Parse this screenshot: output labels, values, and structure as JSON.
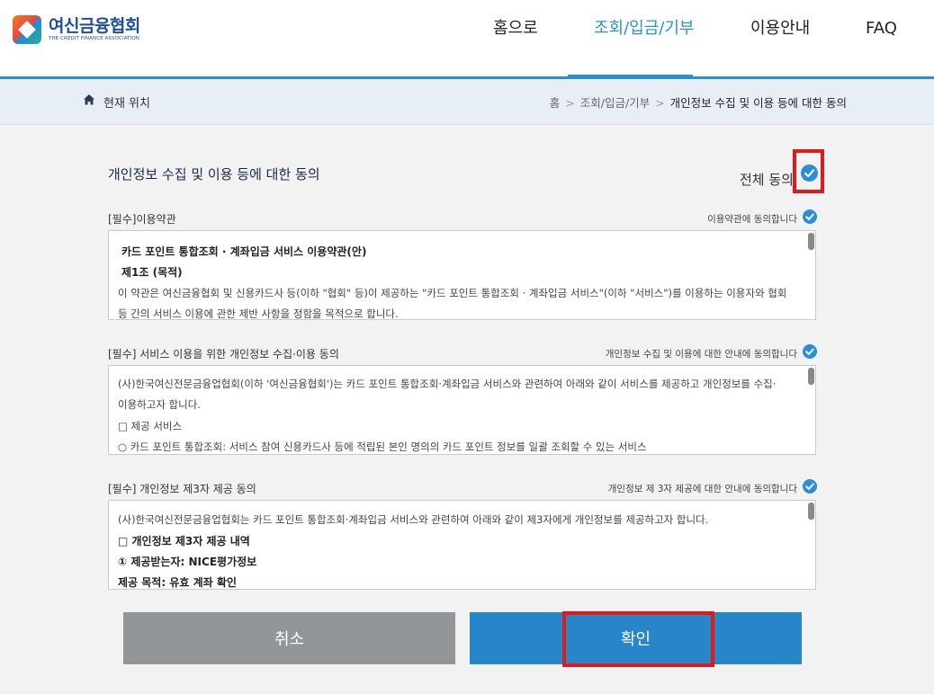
{
  "header": {
    "logo_kr": "여신금융협회",
    "logo_en": "THE CREDIT FINANCE ASSOCIATION",
    "nav": [
      {
        "label": "홈으로"
      },
      {
        "label": "조회/입금/기부",
        "active": true
      },
      {
        "label": "이용안내"
      },
      {
        "label": "FAQ"
      }
    ],
    "accent_color": "#2b8fd6"
  },
  "breadcrumb": {
    "label": "현재 위치",
    "items": [
      "홈",
      "조회/입금/기부",
      "개인정보 수집 및 이용 등에 대한 동의"
    ],
    "separator": ">"
  },
  "main": {
    "title": "개인정보 수집 및 이용 등에 대한 동의",
    "agree_all_label": "전체 동의",
    "sections": [
      {
        "title": "[필수]이용약관",
        "agree_label": "이용약관에 동의합니다",
        "lines": [
          "카드 포인트 통합조회 · 계좌입금 서비스 이용약관(안)",
          "제1조 (목적)",
          "이 약관은 여신금융협회 및 신용카드사 등(이하 \"협회\" 등)이 제공하는 \"카드 포인트 통합조회 · 계좌입금 서비스\"(이하 \"서비스\")를 이용하는 이용자와 협회",
          "등 간의 서비스 이용에 관한 제반 사항을 정함을 목적으로 합니다."
        ]
      },
      {
        "title": "[필수] 서비스 이용을 위한 개인정보 수집·이용 동의",
        "agree_label": "개인정보 수집 및 이용에 대한 안내에 동의합니다",
        "lines": [
          "(사)한국여신전문금융업협회(이하 '여신금융협회')는 카드 포인트 통합조회·계좌입금 서비스와 관련하여 아래와 같이 서비스를 제공하고 개인정보를 수집·",
          "이용하고자 합니다.",
          "□ 제공 서비스",
          "○ 카드 포인트 통합조회: 서비스 참여 신용카드사 등에 적립된 본인 명의의 카드 포인트 정보를 일괄 조회할 수 있는 서비스"
        ]
      },
      {
        "title": "[필수] 개인정보 제3자 제공 동의",
        "agree_label": "개인정보 제 3자 제공에 대한 안내에 동의합니다",
        "lines": [
          "(사)한국여신전문금융업협회는 카드 포인트 통합조회·계좌입금 서비스와 관련하여 아래와 같이 제3자에게 개인정보를 제공하고자 합니다.",
          "□ 개인정보 제3자 제공 내역",
          "① 제공받는자: NICE평가정보",
          "제공 목적: 유효 계좌 확인"
        ]
      }
    ]
  },
  "buttons": {
    "cancel": "취소",
    "confirm": "확인"
  }
}
